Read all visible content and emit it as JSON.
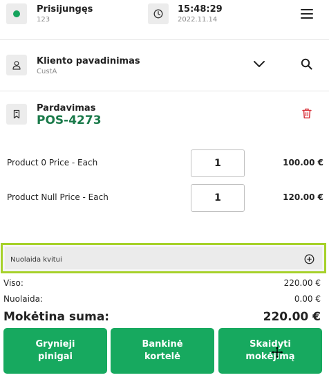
{
  "header": {
    "status_label": "Prisijungęs",
    "status_sub": "123",
    "time": "15:48:29",
    "date": "2022.11.14"
  },
  "customer": {
    "title": "Kliento pavadinimas",
    "subtitle": "CustA"
  },
  "sale": {
    "title": "Pardavimas",
    "id": "POS-4273"
  },
  "items": [
    {
      "name": "Product 0 Price - Each",
      "qty": "1",
      "price": "100.00 €"
    },
    {
      "name": "Product Null Price - Each",
      "qty": "1",
      "price": "120.00 €"
    }
  ],
  "discount": {
    "label": "Nuolaida kvitui"
  },
  "summary": {
    "subtotal_label": "Viso:",
    "subtotal_value": "220.00 €",
    "discount_label": "Nuolaida:",
    "discount_value": "0.00 €",
    "total_label": "Mokėtina suma:",
    "total_value": "220.00 €"
  },
  "payment_buttons": {
    "cash": "Grynieji pinigai",
    "card": "Bankinė kortelė",
    "split": "Skaidyti mokėjimą"
  },
  "colors": {
    "accent_green": "#17a95f",
    "sale_id_green": "#1a7a4a",
    "highlight_border": "#a6d12a",
    "trash_red": "#d9363e"
  },
  "icons": {
    "status": "status-dot-icon",
    "clock": "clock-icon",
    "menu": "hamburger-menu-icon",
    "user": "user-icon",
    "dropdown": "chevron-down-icon",
    "search": "search-icon",
    "bookmark": "bookmark-icon",
    "delete": "trash-icon",
    "add": "plus-circle-icon"
  }
}
